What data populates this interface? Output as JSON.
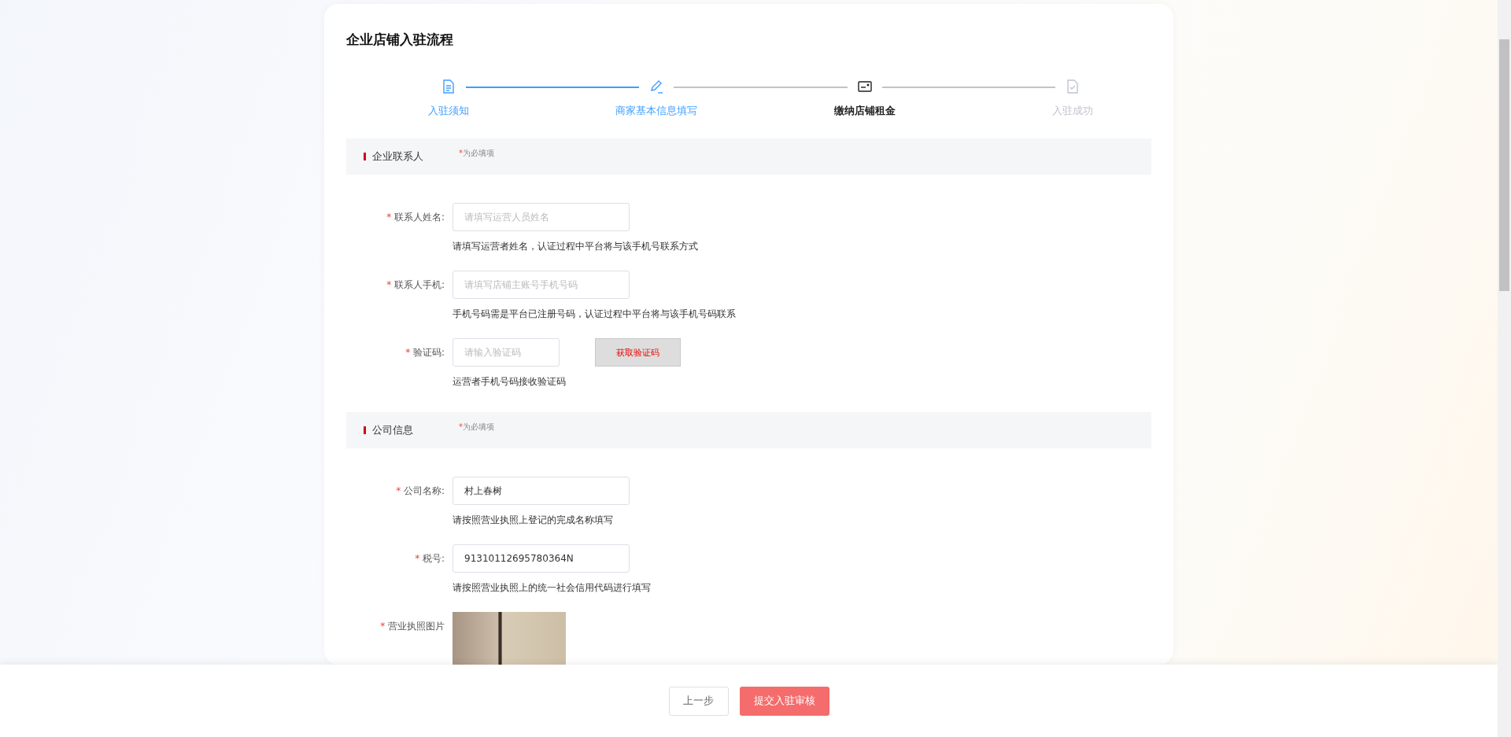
{
  "title": "企业店铺入驻流程",
  "steps": [
    {
      "label": "入驻须知",
      "completed": true,
      "current": false
    },
    {
      "label": "商家基本信息填写",
      "completed": true,
      "current": false
    },
    {
      "label": "缴纳店铺租金",
      "completed": false,
      "current": true
    },
    {
      "label": "入驻成功",
      "completed": false,
      "current": false
    }
  ],
  "sections": [
    {
      "title": "企业联系人",
      "required_mark": "*",
      "required_note": "为必填项",
      "fields": [
        {
          "kind": "input",
          "label": "联系人姓名:",
          "required": true,
          "placeholder": "请填写运营人员姓名",
          "hint": "请填写运营者姓名，认证过程中平台将与该手机号联系方式"
        },
        {
          "kind": "input",
          "label": "联系人手机:",
          "required": true,
          "placeholder": "请填写店铺主账号手机号码",
          "hint": "手机号码需是平台已注册号码，认证过程中平台将与该手机号码联系"
        },
        {
          "kind": "code",
          "label": "验证码:",
          "required": true,
          "placeholder": "请输入验证码",
          "button": "获取验证码",
          "hint": "运营者手机号码接收验证码"
        }
      ]
    },
    {
      "title": "公司信息",
      "required_mark": "*",
      "required_note": "为必填项",
      "fields": [
        {
          "kind": "input",
          "label": "公司名称:",
          "required": true,
          "value": "村上春树",
          "hint": "请按照营业执照上登记的完成名称填写"
        },
        {
          "kind": "input",
          "label": "税号:",
          "required": true,
          "value": "91310112695780364N",
          "hint": "请按照营业执照上的统一社会信用代码进行填写"
        },
        {
          "kind": "image",
          "label": "营业执照图片",
          "required": true
        }
      ]
    }
  ],
  "footer": {
    "buttons": [
      {
        "label": "上一步",
        "kind": "secondary"
      },
      {
        "label": "提交入驻审核",
        "kind": "primary"
      }
    ]
  }
}
